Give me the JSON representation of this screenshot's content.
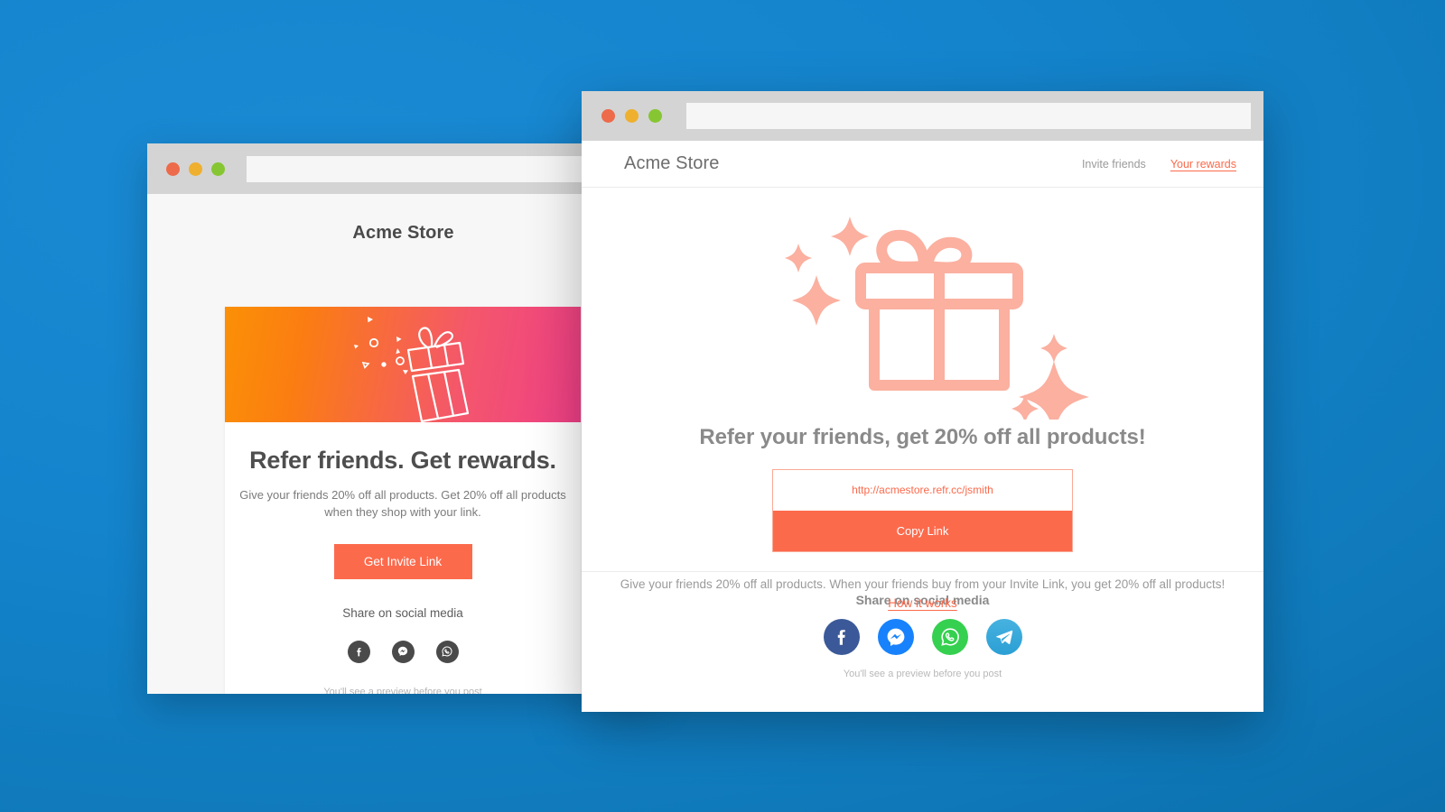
{
  "background": {
    "color_light": "#1a8ad4",
    "color_dark": "#0a6ba6"
  },
  "colors": {
    "accent": "#fc6a4c",
    "accent_border": "#fba996",
    "gift_art": "#fbb0a0",
    "banner_from": "#fb9006",
    "banner_to": "#ef3f87",
    "facebook": "#3b5998",
    "messenger": "#1782fc",
    "whatsapp": "#35d04f",
    "telegram": "#2b9fd4"
  },
  "back_window": {
    "traffic_lights": [
      "close",
      "minimize",
      "zoom"
    ],
    "url_value": "",
    "url_placeholder": "",
    "store_title": "Acme Store",
    "banner_icon": "gift-confetti-illustration",
    "headline": "Refer friends. Get rewards.",
    "subtext": "Give your friends 20% off all products. Get 20% off all products when they shop with your link.",
    "cta_label": "Get Invite Link",
    "share_label": "Share on social media",
    "socials": [
      {
        "name": "facebook",
        "icon": "facebook-icon"
      },
      {
        "name": "messenger",
        "icon": "messenger-icon"
      },
      {
        "name": "whatsapp",
        "icon": "whatsapp-icon"
      }
    ],
    "footnote": "You'll see a preview before you post"
  },
  "front_window": {
    "traffic_lights": [
      "close",
      "minimize",
      "zoom"
    ],
    "url_value": "",
    "url_placeholder": "",
    "brand": "Acme Store",
    "nav": [
      {
        "label": "Invite friends",
        "active": false
      },
      {
        "label": "Your rewards",
        "active": true
      }
    ],
    "hero_icon": "gift-sparkles-illustration",
    "headline": "Refer your friends, get 20% off all products!",
    "invite_link": "http://acmestore.refr.cc/jsmith",
    "copy_label": "Copy Link",
    "description": "Give your friends 20% off all products. When your friends buy from your Invite Link, you get 20% off all products!",
    "how_it_works_label": "How it works",
    "footer_title": "Share on social media",
    "socials": [
      {
        "name": "facebook",
        "icon": "facebook-icon",
        "color": "#3b5998"
      },
      {
        "name": "messenger",
        "icon": "messenger-icon",
        "color": "#1782fc"
      },
      {
        "name": "whatsapp",
        "icon": "whatsapp-icon",
        "color": "#35d04f"
      },
      {
        "name": "telegram",
        "icon": "telegram-icon",
        "color": "#2b9fd4"
      }
    ],
    "footer_note": "You'll see a preview before you post"
  }
}
